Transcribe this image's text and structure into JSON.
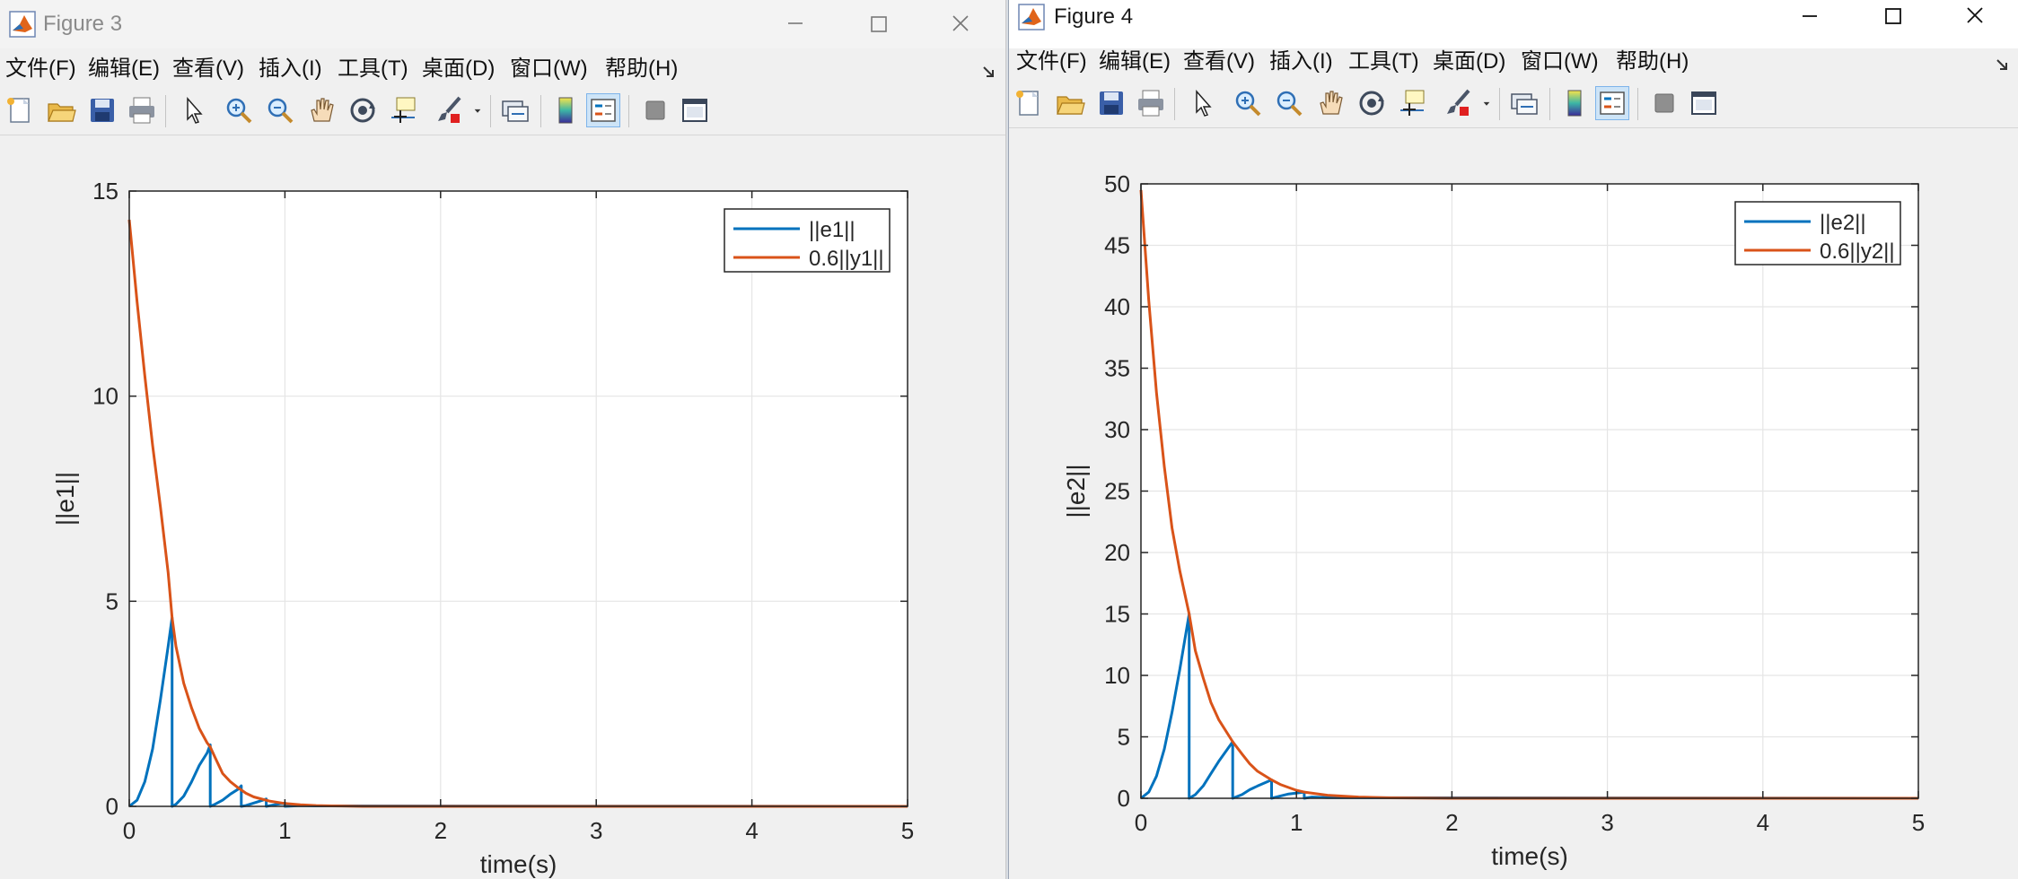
{
  "figure3": {
    "title": "Figure 3",
    "menu": [
      "文件(F)",
      "编辑(E)",
      "查看(V)",
      "插入(I)",
      "工具(T)",
      "桌面(D)",
      "窗口(W)",
      "帮助(H)"
    ]
  },
  "figure4": {
    "title": "Figure 4",
    "menu": [
      "文件(F)",
      "编辑(E)",
      "查看(V)",
      "插入(I)",
      "工具(T)",
      "桌面(D)",
      "窗口(W)",
      "帮助(H)"
    ]
  },
  "toolbar_icons": [
    "new-figure-icon",
    "open-file-icon",
    "save-icon",
    "print-icon",
    "pointer-icon",
    "zoom-in-icon",
    "zoom-out-icon",
    "pan-hand-icon",
    "rotate-3d-icon",
    "data-cursor-icon",
    "brush-icon",
    "brush-dropdown-icon",
    "link-plot-icon",
    "colorbar-icon",
    "legend-icon",
    "hide-plot-tools-icon",
    "show-plot-tools-icon"
  ],
  "colors": {
    "e_series": "#0072bd",
    "y_series": "#d95319",
    "grid": "#e5e5e5"
  },
  "chart_data": [
    {
      "type": "line",
      "xlabel": "time(s)",
      "ylabel": "||e1||",
      "xlim": [
        0,
        5
      ],
      "ylim": [
        0,
        15
      ],
      "xticks": [
        0,
        1,
        2,
        3,
        4,
        5
      ],
      "yticks": [
        0,
        5,
        10,
        15
      ],
      "grid": true,
      "legend_position": "top-right",
      "series": [
        {
          "name": "||e1||",
          "color": "#0072bd",
          "x": [
            0,
            0.05,
            0.1,
            0.15,
            0.2,
            0.25,
            0.275,
            0.275,
            0.3,
            0.35,
            0.4,
            0.45,
            0.5,
            0.52,
            0.52,
            0.55,
            0.6,
            0.65,
            0.7,
            0.72,
            0.72,
            0.75,
            0.8,
            0.85,
            0.88,
            0.88,
            0.95,
            1.0,
            1.0,
            1.1,
            1.2,
            5.0
          ],
          "y": [
            0,
            0.15,
            0.6,
            1.4,
            2.6,
            3.9,
            4.6,
            0,
            0.05,
            0.25,
            0.6,
            1.0,
            1.3,
            1.5,
            0,
            0.05,
            0.15,
            0.3,
            0.42,
            0.5,
            0,
            0.02,
            0.08,
            0.14,
            0.18,
            0,
            0.05,
            0.08,
            0,
            0.02,
            0.01,
            0
          ]
        },
        {
          "name": "0.6||y1||",
          "color": "#d95319",
          "x": [
            0,
            0.05,
            0.1,
            0.15,
            0.2,
            0.25,
            0.275,
            0.3,
            0.35,
            0.4,
            0.45,
            0.5,
            0.52,
            0.55,
            0.6,
            0.65,
            0.7,
            0.75,
            0.8,
            0.9,
            1.0,
            1.1,
            1.2,
            1.3,
            1.5,
            2.0,
            5.0
          ],
          "y": [
            14.3,
            12.3,
            10.5,
            8.8,
            7.3,
            5.7,
            4.6,
            3.9,
            3.0,
            2.4,
            1.9,
            1.55,
            1.45,
            1.2,
            0.8,
            0.6,
            0.45,
            0.32,
            0.23,
            0.13,
            0.07,
            0.04,
            0.02,
            0.01,
            0.0,
            0,
            0
          ]
        }
      ]
    },
    {
      "type": "line",
      "xlabel": "time(s)",
      "ylabel": "||e2||",
      "xlim": [
        0,
        5
      ],
      "ylim": [
        0,
        50
      ],
      "xticks": [
        0,
        1,
        2,
        3,
        4,
        5
      ],
      "yticks": [
        0,
        5,
        10,
        15,
        20,
        25,
        30,
        35,
        40,
        45,
        50
      ],
      "grid": true,
      "legend_position": "top-right",
      "series": [
        {
          "name": "||e2||",
          "color": "#0072bd",
          "x": [
            0,
            0.05,
            0.1,
            0.15,
            0.2,
            0.25,
            0.31,
            0.31,
            0.35,
            0.4,
            0.45,
            0.5,
            0.59,
            0.59,
            0.65,
            0.7,
            0.75,
            0.84,
            0.84,
            0.9,
            0.95,
            1.05,
            1.05,
            1.1,
            1.2,
            5.0
          ],
          "y": [
            0,
            0.5,
            1.8,
            4.0,
            7.0,
            10.5,
            15.0,
            0,
            0.3,
            1.0,
            2.0,
            3.0,
            4.6,
            0,
            0.3,
            0.7,
            1.0,
            1.5,
            0,
            0.2,
            0.35,
            0.5,
            0,
            0.1,
            0.05,
            0
          ]
        },
        {
          "name": "0.6||y2||",
          "color": "#d95319",
          "x": [
            0,
            0.05,
            0.1,
            0.15,
            0.2,
            0.25,
            0.31,
            0.35,
            0.4,
            0.45,
            0.5,
            0.59,
            0.65,
            0.7,
            0.75,
            0.84,
            0.9,
            1.0,
            1.05,
            1.2,
            1.4,
            1.6,
            2.0,
            5.0
          ],
          "y": [
            49.5,
            40.5,
            33.0,
            27.0,
            22.0,
            18.5,
            15.0,
            12.0,
            9.8,
            7.8,
            6.4,
            4.6,
            3.6,
            2.8,
            2.2,
            1.5,
            1.1,
            0.65,
            0.5,
            0.25,
            0.1,
            0.04,
            0,
            0
          ]
        }
      ]
    }
  ]
}
